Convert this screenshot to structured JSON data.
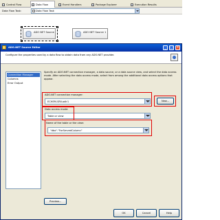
{
  "tabs": [
    {
      "label": "Control Flow",
      "icon": "control-flow-icon"
    },
    {
      "label": "Data Flow",
      "icon": "data-flow-icon"
    },
    {
      "label": "Event Handlers",
      "icon": "event-handlers-icon"
    },
    {
      "label": "Package Explorer",
      "icon": "package-explorer-icon"
    },
    {
      "label": "Execution Results",
      "icon": "execution-results-icon"
    }
  ],
  "task_bar": {
    "label": "Data Flow Task:",
    "value": "Data Flow Task"
  },
  "designer": {
    "components": [
      {
        "label": "ADO NET Source",
        "icon": "ado-net-source-icon"
      },
      {
        "label": "ADO NET Source 1",
        "icon": "ado-net-source-icon"
      }
    ]
  },
  "dialog": {
    "title": "ADO.NET Source Editor",
    "title_buttons": [
      "_",
      "□",
      "×"
    ],
    "header_text": "Configure the properties used by a data flow to obtain data from any ADO.NET provider.",
    "nav_items": [
      "Connection Manager",
      "Columns",
      "Error Output"
    ],
    "instructions": "Specify an ADO.NET connection manager, a data source, or a data source view, and select the data access mode. After selecting the data access mode, select from among the additional data access options that appear.",
    "connection_manager": {
      "label": "ADO.NET connection manager:",
      "value": "ECHEM-SRV.adlr1"
    },
    "new_button": "New...",
    "access_mode": {
      "label": "Data access mode:",
      "value": "Table or view"
    },
    "table": {
      "label": "Name of the table or the view:",
      "value": "\"dbo\".\"ForServedColumn\""
    },
    "preview_button": "Preview...",
    "ok_button": "OK",
    "cancel_button": "Cancel",
    "help_button": "Help"
  },
  "colors": {
    "highlight": "#e00000",
    "selection": "#316ac5",
    "title_bar": "#0a5fd8"
  }
}
